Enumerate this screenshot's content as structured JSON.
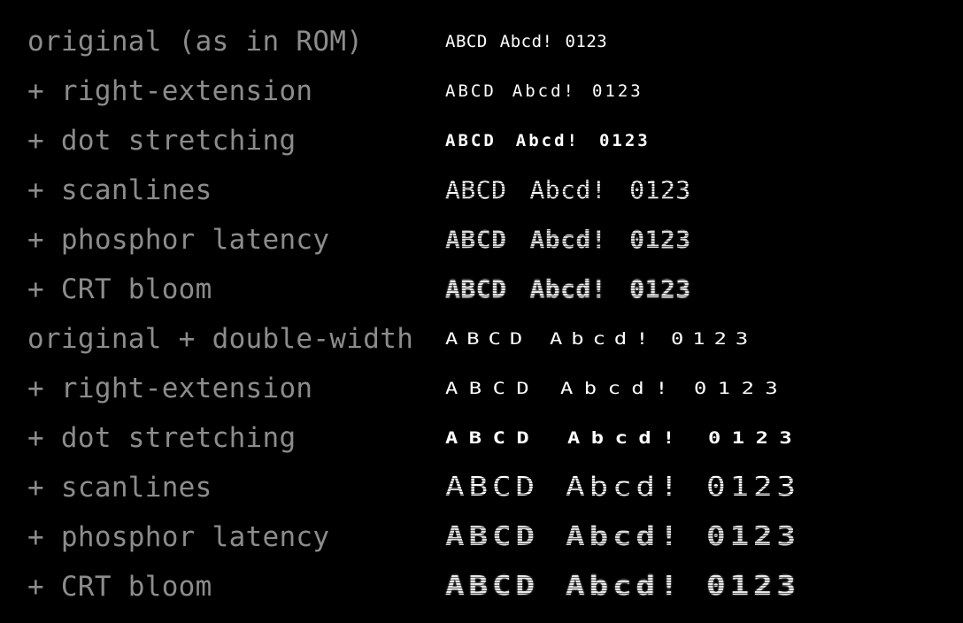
{
  "rows": [
    {
      "label": "original (as in ROM)",
      "words": [
        "ABCD",
        "Abcd!",
        "0123"
      ]
    },
    {
      "label": "+ right-extension",
      "words": [
        "ABCD",
        "Abcd!",
        "0123"
      ]
    },
    {
      "label": "+ dot stretching",
      "words": [
        "ABCD",
        "Abcd!",
        "0123"
      ]
    },
    {
      "label": "+ scanlines",
      "words": [
        "ABCD",
        "Abcd!",
        "0123"
      ]
    },
    {
      "label": "+ phosphor latency",
      "words": [
        "ABCD",
        "Abcd!",
        "0123"
      ]
    },
    {
      "label": "+ CRT bloom",
      "words": [
        "ABCD",
        "Abcd!",
        "0123"
      ]
    },
    {
      "label": "original + double-width",
      "words": [
        "ABCD",
        "Abcd!",
        "0123"
      ]
    },
    {
      "label": "+ right-extension",
      "words": [
        "ABCD",
        "Abcd!",
        "0123"
      ]
    },
    {
      "label": "+ dot stretching",
      "words": [
        "ABCD",
        "Abcd!",
        "0123"
      ]
    },
    {
      "label": "+ scanlines",
      "words": [
        "ABCD",
        "Abcd!",
        "0123"
      ]
    },
    {
      "label": "+ phosphor latency",
      "words": [
        "ABCD",
        "Abcd!",
        "0123"
      ]
    },
    {
      "label": "+ CRT bloom",
      "words": [
        "ABCD",
        "Abcd!",
        "0123"
      ]
    }
  ],
  "colors": {
    "background": "#000000",
    "label": "#8c8c8c",
    "sample": "#ffffff"
  }
}
